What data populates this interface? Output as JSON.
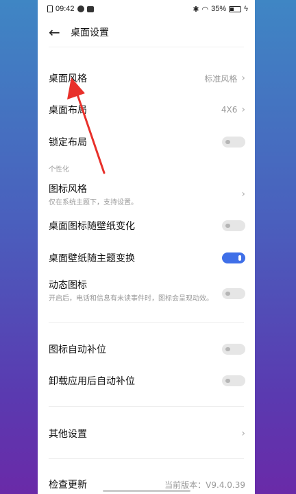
{
  "status_bar": {
    "time": "09:42",
    "battery": "35%",
    "icons": [
      "sim-icon",
      "face-icon",
      "notification-icon",
      "bluetooth-icon",
      "wifi-icon",
      "battery-icon",
      "charging-icon"
    ]
  },
  "header": {
    "back_icon": "back-arrow-icon",
    "title": "桌面设置"
  },
  "settings": {
    "desktop_style": {
      "label": "桌面风格",
      "value": "标准风格"
    },
    "desktop_layout": {
      "label": "桌面布局",
      "value": "4X6"
    },
    "lock_layout": {
      "label": "锁定布局",
      "on": false
    },
    "personalization_header": "个性化",
    "icon_style": {
      "label": "图标风格",
      "sub": "仅在系统主题下，支持设置。"
    },
    "icon_follow_wallpaper": {
      "label": "桌面图标随壁纸变化",
      "on": false
    },
    "wallpaper_follow_theme": {
      "label": "桌面壁纸随主题变换",
      "on": true
    },
    "dynamic_icons": {
      "label": "动态图标",
      "sub": "开启后，电话和信息有未读事件时，图标会呈现动效。",
      "on": false
    },
    "icon_auto_fill": {
      "label": "图标自动补位",
      "on": false
    },
    "uninstall_auto_fill": {
      "label": "卸载应用后自动补位",
      "on": false
    },
    "other_settings": {
      "label": "其他设置"
    },
    "check_update": {
      "label": "检查更新",
      "value": "当前版本：V9.4.0.39"
    }
  },
  "colors": {
    "accent": "#3f6fe8",
    "annotation_arrow": "#e8302a"
  }
}
